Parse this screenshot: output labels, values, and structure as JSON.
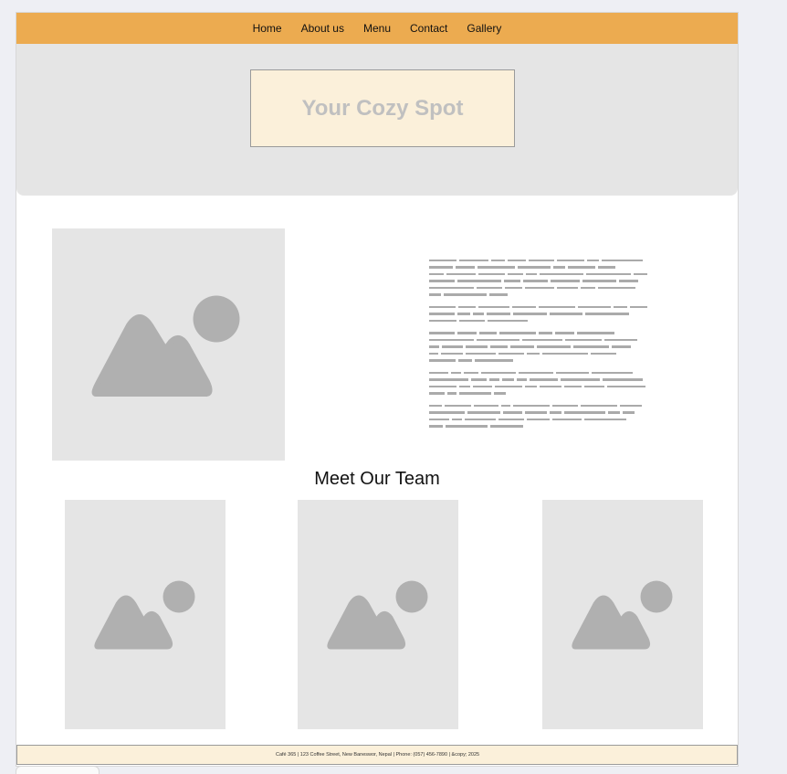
{
  "nav": {
    "items": [
      {
        "label": "Home"
      },
      {
        "label": "About us"
      },
      {
        "label": "Menu"
      },
      {
        "label": "Contact"
      },
      {
        "label": "Gallery"
      }
    ]
  },
  "hero": {
    "title": "Your Cozy Spot"
  },
  "team": {
    "heading": "Meet Our Team"
  },
  "footer": {
    "text": "Café 365 | 123 Coffee Street, New Baneswor, Nepal | Phone: (057) 456-7890 | &copy; 2025"
  },
  "colors": {
    "nav_bg": "#ecab50",
    "hero_bg": "#e5e5e5",
    "hero_box_bg": "#fbf0da",
    "placeholder_icon": "#b0b0b0"
  },
  "icons": {
    "image_placeholder": "image-placeholder-icon"
  }
}
